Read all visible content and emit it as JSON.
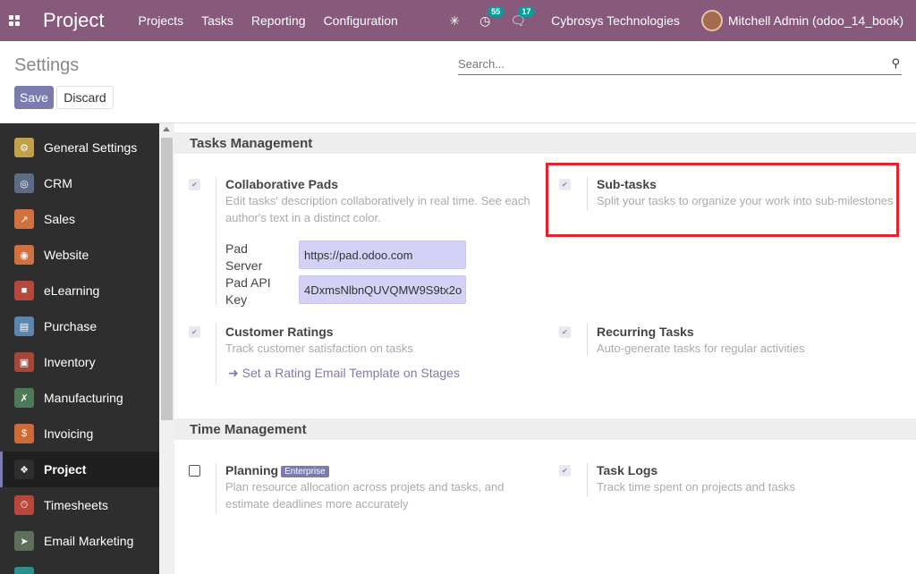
{
  "topbar": {
    "brand": "Project",
    "menu": [
      "Projects",
      "Tasks",
      "Reporting",
      "Configuration"
    ],
    "activity_count": "55",
    "message_count": "17",
    "company": "Cybrosys Technologies",
    "user": "Mitchell Admin (odoo_14_book)"
  },
  "control_panel": {
    "title": "Settings",
    "search_placeholder": "Search...",
    "save_label": "Save",
    "discard_label": "Discard"
  },
  "sidebar": {
    "items": [
      {
        "label": "General Settings",
        "icon": "gear-icon",
        "color": "#c2a14c"
      },
      {
        "label": "CRM",
        "icon": "handshake-icon",
        "color": "#5d6c84"
      },
      {
        "label": "Sales",
        "icon": "chart-icon",
        "color": "#d1713f"
      },
      {
        "label": "Website",
        "icon": "globe-icon",
        "color": "#d1713f"
      },
      {
        "label": "eLearning",
        "icon": "elearning-icon",
        "color": "#b5473f"
      },
      {
        "label": "Purchase",
        "icon": "purchase-icon",
        "color": "#5c86b0"
      },
      {
        "label": "Inventory",
        "icon": "box-icon",
        "color": "#a6473a"
      },
      {
        "label": "Manufacturing",
        "icon": "wrench-icon",
        "color": "#4d7b5a"
      },
      {
        "label": "Invoicing",
        "icon": "invoice-icon",
        "color": "#cc6a38"
      },
      {
        "label": "Project",
        "icon": "puzzle-icon",
        "color": "#2e2e2e"
      },
      {
        "label": "Timesheets",
        "icon": "stopwatch-icon",
        "color": "#b9463c"
      },
      {
        "label": "Email Marketing",
        "icon": "paper-plane-icon",
        "color": "#5f6f5a"
      }
    ]
  },
  "tasks_management": {
    "heading": "Tasks Management",
    "collab_pads": {
      "title": "Collaborative Pads",
      "desc": "Edit tasks' description collaboratively in real time. See each author's text in a distinct color.",
      "pad_server_label": "Pad Server",
      "pad_server_value": "https://pad.odoo.com",
      "pad_key_label": "Pad API Key",
      "pad_key_value": "4DxmsNlbnQUVQMW9S9tx2o"
    },
    "subtasks": {
      "title": "Sub-tasks",
      "desc": "Split your tasks to organize your work into sub-milestones"
    },
    "customer_ratings": {
      "title": "Customer Ratings",
      "desc": "Track customer satisfaction on tasks",
      "link": "Set a Rating Email Template on Stages"
    },
    "recurring": {
      "title": "Recurring Tasks",
      "desc": "Auto-generate tasks for regular activities"
    }
  },
  "time_management": {
    "heading": "Time Management",
    "planning": {
      "title": "Planning",
      "badge": "Enterprise",
      "desc": "Plan resource allocation across projets and tasks, and estimate deadlines more accurately"
    },
    "task_logs": {
      "title": "Task Logs",
      "desc": "Track time spent on projects and tasks"
    }
  }
}
